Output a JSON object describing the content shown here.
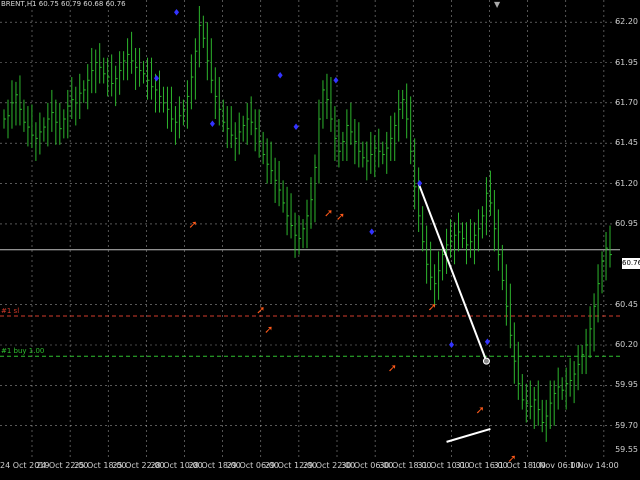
{
  "header": {
    "symbol_line": "BRENT,H1  60.75 60.79 60.68 60.76"
  },
  "price_axis": {
    "labels": [
      "62.20",
      "61.95",
      "61.70",
      "61.45",
      "61.20",
      "60.95",
      "60.76",
      "60.45",
      "60.20",
      "59.95",
      "59.70",
      "59.55"
    ],
    "current_bid": "60.76"
  },
  "time_axis": {
    "labels": [
      "24 Oct 2019",
      "24 Oct 22:00",
      "25 Oct 18:00",
      "25 Oct 22:00",
      "28 Oct 10:00",
      "28 Oct 18:00",
      "29 Oct 06:00",
      "29 Oct 12:00",
      "29 Oct 22:00",
      "30 Oct 06:00",
      "30 Oct 18:00",
      "31 Oct 10:00",
      "31 Oct 16:00",
      "31 Oct 18:00",
      "1 Nov 06:00",
      "1 Nov 14:00"
    ]
  },
  "levels": [
    {
      "label": "#1 sl",
      "color": "#d23b2b"
    },
    {
      "label": "#1 buy 1.00",
      "color": "#2fbf2f"
    }
  ],
  "colors": {
    "background": "#000000",
    "grid": "#c8c8c8",
    "bar": "#2db52d",
    "up_arrow": "#ff5a1a",
    "blue_marker": "#3333ff",
    "trendline": "#ffffff",
    "bid_line": "#c0c0c0"
  },
  "chart_data": {
    "type": "bar",
    "title": "BRENT,H1",
    "series": [
      {
        "name": "BRENT H1",
        "values": [
          61.6,
          61.62,
          61.7,
          61.75,
          61.66,
          61.58,
          61.55,
          61.5,
          61.48,
          61.52,
          61.55,
          61.6,
          61.64,
          61.58,
          61.54,
          61.6,
          61.68,
          61.72,
          61.7,
          61.76,
          61.78,
          61.84,
          61.9,
          61.95,
          61.92,
          61.88,
          61.86,
          61.82,
          61.85,
          61.9,
          61.96,
          62.0,
          61.96,
          61.92,
          61.9,
          61.88,
          61.84,
          61.8,
          61.78,
          61.74,
          61.7,
          61.66,
          61.6,
          61.58,
          61.62,
          61.66,
          61.74,
          61.86,
          62.02,
          62.18,
          62.1,
          61.96,
          61.84,
          61.74,
          61.66,
          61.58,
          61.54,
          61.5,
          61.48,
          61.52,
          61.56,
          61.6,
          61.58,
          61.54,
          61.46,
          61.38,
          61.32,
          61.28,
          61.22,
          61.16,
          61.08,
          61.0,
          60.94,
          60.88,
          60.86,
          60.92,
          61.0,
          61.1,
          61.3,
          61.6,
          61.78,
          61.72,
          61.6,
          61.48,
          61.4,
          61.46,
          61.56,
          61.52,
          61.46,
          61.4,
          61.36,
          61.34,
          61.38,
          61.42,
          61.4,
          61.38,
          61.42,
          61.48,
          61.56,
          61.66,
          61.72,
          61.6,
          61.4,
          61.18,
          61.0,
          60.84,
          60.7,
          60.62,
          60.58,
          60.66,
          60.76,
          60.82,
          60.84,
          60.88,
          60.9,
          60.86,
          60.82,
          60.84,
          60.88,
          60.92,
          61.0,
          61.14,
          61.08,
          60.92,
          60.76,
          60.6,
          60.44,
          60.26,
          60.1,
          59.96,
          59.86,
          59.84,
          59.82,
          59.86,
          59.8,
          59.72,
          59.76,
          59.84,
          59.9,
          59.94,
          59.92,
          59.96,
          59.98,
          60.02,
          60.08,
          60.14,
          60.2,
          60.3,
          60.44,
          60.58,
          60.72,
          60.8,
          60.76
        ]
      }
    ],
    "ylim": [
      59.5,
      62.3
    ],
    "ylabel": "",
    "xlabel": "",
    "grid": true,
    "annotations": {
      "up_arrows": [
        {
          "index": 47,
          "price": 60.95
        },
        {
          "index": 64,
          "price": 60.42
        },
        {
          "index": 66,
          "price": 60.3
        },
        {
          "index": 81,
          "price": 61.02
        },
        {
          "index": 84,
          "price": 61.0
        },
        {
          "index": 97,
          "price": 60.06
        },
        {
          "index": 107,
          "price": 60.44
        },
        {
          "index": 119,
          "price": 59.8
        },
        {
          "index": 127,
          "price": 59.5
        }
      ],
      "blue_markers": [
        {
          "index": 43,
          "price": 62.26
        },
        {
          "index": 38,
          "price": 61.85
        },
        {
          "index": 52,
          "price": 61.57
        },
        {
          "index": 69,
          "price": 61.87
        },
        {
          "index": 73,
          "price": 61.55
        },
        {
          "index": 83,
          "price": 61.84
        },
        {
          "index": 92,
          "price": 60.9
        },
        {
          "index": 104,
          "price": 61.2
        },
        {
          "index": 112,
          "price": 60.2
        },
        {
          "index": 121,
          "price": 60.22
        }
      ],
      "trendlines": [
        {
          "from_index": 104,
          "from_price": 61.2,
          "to_index": 121,
          "to_price": 60.1
        },
        {
          "from_index": 111,
          "from_price": 59.6,
          "to_index": 122,
          "to_price": 59.68
        }
      ]
    },
    "horizontal_lines": [
      {
        "name": "bid",
        "price": 60.79
      },
      {
        "name": "#1 sl",
        "price": 60.38
      },
      {
        "name": "#1 buy 1.00",
        "price": 60.13
      }
    ]
  }
}
